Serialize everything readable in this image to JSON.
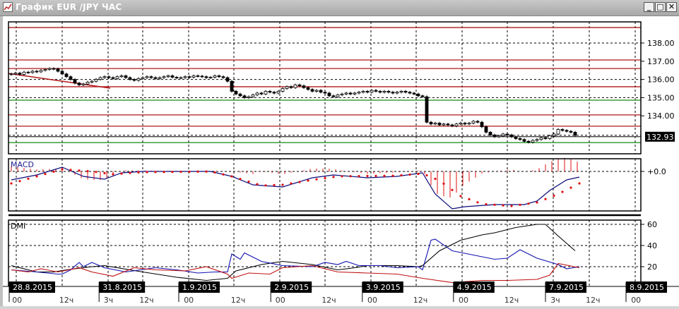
{
  "window": {
    "title": "График EUR /JPY ЧАС",
    "buttons": {
      "minimize": "_",
      "maximize": "□",
      "close": "✕"
    }
  },
  "colors": {
    "up": "#ffffff",
    "down": "#000000",
    "resistance": "#b01818",
    "support": "#138a13",
    "macd": "#0a0a7a",
    "signal": "#e01010",
    "adx": "#000000",
    "plus_di": "#1010b0",
    "minus_di": "#c01010"
  },
  "price_axis": {
    "ticks": [
      "138.00",
      "137.00",
      "136.00",
      "135.00",
      "134.00"
    ],
    "tick_values": [
      138,
      137,
      136,
      135,
      134
    ],
    "current_price": "132.93",
    "current_value": 132.93
  },
  "macd_axis": {
    "label": "MACD",
    "ticks": [
      "+0.0"
    ],
    "tick_values": [
      0
    ]
  },
  "dmi_axis": {
    "label": "DMI",
    "ticks": [
      "60",
      "40",
      "20"
    ],
    "tick_values": [
      60,
      40,
      20
    ]
  },
  "chart_data": [
    {
      "type": "candlestick",
      "title": "EUR/JPY 1H",
      "ylim": [
        132.2,
        139.1
      ],
      "closes": [
        136.3,
        136.35,
        136.28,
        136.4,
        136.38,
        136.45,
        136.42,
        136.5,
        136.55,
        136.6,
        136.58,
        136.45,
        136.3,
        136.15,
        136.0,
        135.8,
        135.7,
        135.75,
        135.85,
        135.9,
        136.0,
        136.1,
        136.15,
        136.1,
        136.05,
        136.15,
        136.2,
        136.1,
        136.0,
        135.95,
        136.05,
        136.1,
        136.15,
        136.1,
        136.05,
        136.1,
        136.15,
        136.2,
        136.12,
        136.08,
        136.1,
        136.15,
        136.12,
        136.2,
        136.18,
        136.15,
        136.1,
        136.12,
        136.2,
        136.15,
        136.1,
        135.9,
        135.35,
        135.2,
        135.1,
        135.0,
        135.05,
        135.15,
        135.25,
        135.2,
        135.35,
        135.3,
        135.25,
        135.35,
        135.5,
        135.6,
        135.55,
        135.7,
        135.65,
        135.55,
        135.45,
        135.35,
        135.4,
        135.3,
        135.25,
        135.1,
        135.05,
        135.15,
        135.2,
        135.25,
        135.2,
        135.25,
        135.3,
        135.35,
        135.3,
        135.4,
        135.35,
        135.3,
        135.35,
        135.3,
        135.25,
        135.3,
        135.35,
        135.3,
        135.25,
        135.2,
        135.1,
        135.05,
        133.65,
        133.55,
        133.6,
        133.5,
        133.55,
        133.5,
        133.45,
        133.55,
        133.6,
        133.55,
        133.6,
        133.7,
        133.65,
        133.4,
        133.1,
        132.95,
        132.85,
        132.9,
        133.0,
        132.95,
        132.85,
        132.75,
        132.7,
        132.6,
        132.55,
        132.65,
        132.7,
        132.8,
        132.75,
        132.9,
        133.0,
        133.25,
        133.2,
        133.15,
        133.1,
        132.93
      ],
      "resistance_levels": [
        138.85,
        137.07,
        136.6,
        135.6,
        134.05,
        133.43
      ],
      "support_levels": [
        134.86,
        132.53
      ],
      "trendline": [
        [
          0,
          136.33
        ],
        [
          23,
          135.52
        ]
      ]
    },
    {
      "type": "line",
      "title": "MACD",
      "series": [
        {
          "name": "MACD",
          "points": [
            [
              0,
              -0.12
            ],
            [
              6,
              -0.05
            ],
            [
              12,
              0.06
            ],
            [
              17,
              -0.07
            ],
            [
              22,
              -0.11
            ],
            [
              26,
              -0.02
            ],
            [
              31,
              0
            ],
            [
              47,
              0
            ],
            [
              52,
              -0.07
            ],
            [
              57,
              -0.19
            ],
            [
              64,
              -0.22
            ],
            [
              71,
              -0.09
            ],
            [
              76,
              -0.05
            ],
            [
              84,
              -0.09
            ],
            [
              91,
              -0.07
            ],
            [
              97,
              -0.02
            ],
            [
              100,
              -0.32
            ],
            [
              104,
              -0.53
            ],
            [
              107,
              -0.5
            ],
            [
              114,
              -0.47
            ],
            [
              121,
              -0.47
            ],
            [
              124,
              -0.42
            ],
            [
              127,
              -0.27
            ],
            [
              131,
              -0.12
            ],
            [
              134,
              -0.08
            ]
          ]
        },
        {
          "name": "Signal",
          "points": [
            [
              0,
              -0.17
            ],
            [
              6,
              -0.07
            ],
            [
              12,
              0.03
            ],
            [
              19,
              0
            ],
            [
              24,
              -0.04
            ],
            [
              31,
              -0.01
            ],
            [
              47,
              0
            ],
            [
              52,
              -0.07
            ],
            [
              59,
              -0.2
            ],
            [
              64,
              -0.19
            ],
            [
              71,
              -0.12
            ],
            [
              77,
              -0.07
            ],
            [
              91,
              -0.06
            ],
            [
              97,
              -0.03
            ],
            [
              101,
              -0.13
            ],
            [
              106,
              -0.35
            ],
            [
              111,
              -0.46
            ],
            [
              118,
              -0.49
            ],
            [
              124,
              -0.44
            ],
            [
              129,
              -0.32
            ],
            [
              134,
              -0.17
            ]
          ]
        }
      ],
      "ylim": [
        -0.57,
        0.19
      ]
    },
    {
      "type": "line",
      "title": "DMI",
      "series": [
        {
          "name": "ADX",
          "points": [
            [
              0,
              21
            ],
            [
              6,
              15
            ],
            [
              10,
              15
            ],
            [
              13,
              17
            ],
            [
              19,
              20
            ],
            [
              22,
              21
            ],
            [
              31,
              15
            ],
            [
              39,
              10
            ],
            [
              46,
              7
            ],
            [
              51,
              9
            ],
            [
              53,
              16
            ],
            [
              59,
              22
            ],
            [
              64,
              25
            ],
            [
              71,
              22
            ],
            [
              77,
              17
            ],
            [
              81,
              19
            ],
            [
              84,
              21
            ],
            [
              91,
              21
            ],
            [
              96,
              20
            ],
            [
              97,
              21
            ],
            [
              101,
              35
            ],
            [
              106,
              45
            ],
            [
              111,
              50
            ],
            [
              114,
              52
            ],
            [
              119,
              57
            ],
            [
              124,
              60
            ],
            [
              126,
              60
            ],
            [
              129,
              49
            ],
            [
              133,
              35
            ]
          ]
        },
        {
          "name": "+DI",
          "points": [
            [
              0,
              17
            ],
            [
              6,
              15
            ],
            [
              11,
              13
            ],
            [
              12,
              13
            ],
            [
              14,
              17
            ],
            [
              16,
              24
            ],
            [
              17,
              20
            ],
            [
              19,
              24
            ],
            [
              22,
              19
            ],
            [
              27,
              15
            ],
            [
              34,
              19
            ],
            [
              39,
              17
            ],
            [
              44,
              14
            ],
            [
              48,
              15
            ],
            [
              51,
              15
            ],
            [
              52,
              32
            ],
            [
              54,
              27
            ],
            [
              55,
              33
            ],
            [
              59,
              25
            ],
            [
              64,
              21
            ],
            [
              71,
              20
            ],
            [
              74,
              24
            ],
            [
              77,
              22
            ],
            [
              79,
              25
            ],
            [
              82,
              21
            ],
            [
              87,
              21
            ],
            [
              91,
              19
            ],
            [
              96,
              20
            ],
            [
              97,
              17
            ],
            [
              99,
              45
            ],
            [
              100,
              46
            ],
            [
              104,
              35
            ],
            [
              109,
              31
            ],
            [
              114,
              27
            ],
            [
              117,
              28
            ],
            [
              120,
              36
            ],
            [
              124,
              28
            ],
            [
              129,
              22
            ],
            [
              131,
              18
            ],
            [
              134,
              20
            ]
          ]
        },
        {
          "name": "-DI",
          "points": [
            [
              0,
              17
            ],
            [
              4,
              15
            ],
            [
              7,
              18
            ],
            [
              11,
              15
            ],
            [
              16,
              19
            ],
            [
              19,
              15
            ],
            [
              24,
              11
            ],
            [
              29,
              19
            ],
            [
              34,
              17
            ],
            [
              41,
              16
            ],
            [
              46,
              20
            ],
            [
              51,
              13
            ],
            [
              52,
              9
            ],
            [
              56,
              14
            ],
            [
              61,
              13
            ],
            [
              64,
              19
            ],
            [
              71,
              21
            ],
            [
              77,
              15
            ],
            [
              84,
              14
            ],
            [
              91,
              13
            ],
            [
              97,
              9
            ],
            [
              104,
              5
            ],
            [
              111,
              7
            ],
            [
              117,
              7
            ],
            [
              124,
              8
            ],
            [
              127,
              12
            ],
            [
              129,
              23
            ],
            [
              134,
              19
            ]
          ]
        }
      ],
      "ylim": [
        0,
        63
      ]
    }
  ],
  "time_axis": {
    "dates": [
      {
        "label": "28.8.2015",
        "t": -0.5
      },
      {
        "label": "31.8.2015",
        "t": 20.7
      },
      {
        "label": "1.9.2015",
        "t": 39.5
      },
      {
        "label": "2.9.2015",
        "t": 61.2
      },
      {
        "label": "3.9.2015",
        "t": 82.8
      },
      {
        "label": "4.9.2015",
        "t": 104.3
      },
      {
        "label": "7.9.2015",
        "t": 126
      },
      {
        "label": "8.9.2015",
        "t": 145
      }
    ],
    "hours": [
      {
        "label": "00",
        "t": 0.2
      },
      {
        "label": "12ч",
        "t": 11.3
      },
      {
        "label": "3ч",
        "t": 21.8
      },
      {
        "label": "12ч",
        "t": 30.2
      },
      {
        "label": "00",
        "t": 40.7
      },
      {
        "label": "12ч",
        "t": 51.8
      },
      {
        "label": "00",
        "t": 62.3
      },
      {
        "label": "12ч",
        "t": 73.2
      },
      {
        "label": "00",
        "t": 84
      },
      {
        "label": "12ч",
        "t": 94.8
      },
      {
        "label": "00",
        "t": 105.5
      },
      {
        "label": "12ч",
        "t": 116.3
      },
      {
        "label": "3ч",
        "t": 127.2
      },
      {
        "label": "12ч",
        "t": 135.5
      },
      {
        "label": "00",
        "t": 146.2
      }
    ]
  }
}
